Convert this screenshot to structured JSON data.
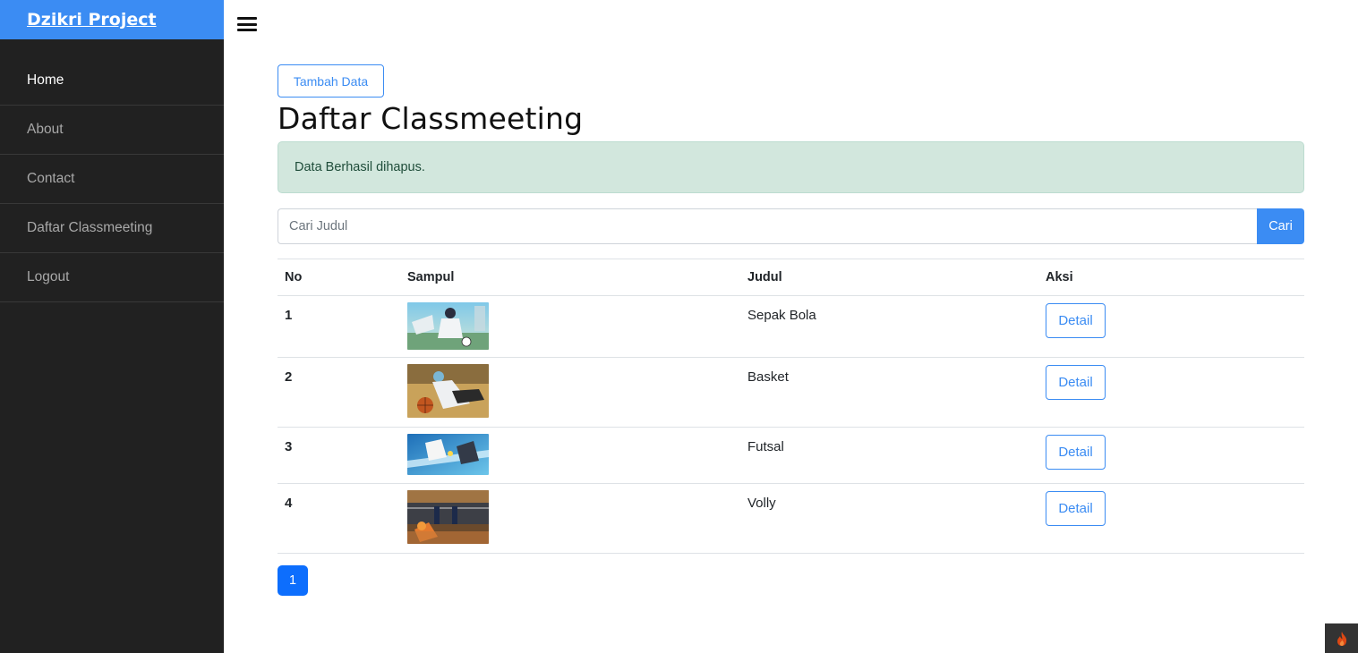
{
  "brand": {
    "name": "Dzikri Project"
  },
  "sidebar": {
    "items": [
      {
        "label": "Home",
        "active": true
      },
      {
        "label": "About",
        "active": false
      },
      {
        "label": "Contact",
        "active": false
      },
      {
        "label": "Daftar Classmeeting",
        "active": false
      },
      {
        "label": "Logout",
        "active": false
      }
    ]
  },
  "main": {
    "add_button": "Tambah Data",
    "title": "Daftar Classmeeting",
    "alert": "Data Berhasil dihapus.",
    "search": {
      "placeholder": "Cari Judul",
      "value": "",
      "button": "Cari"
    },
    "table": {
      "headers": [
        "No",
        "Sampul",
        "Judul",
        "Aksi"
      ],
      "rows": [
        {
          "no": "1",
          "judul": "Sepak Bola",
          "aksi": "Detail"
        },
        {
          "no": "2",
          "judul": "Basket",
          "aksi": "Detail"
        },
        {
          "no": "3",
          "judul": "Futsal",
          "aksi": "Detail"
        },
        {
          "no": "4",
          "judul": "Volly",
          "aksi": "Detail"
        }
      ]
    },
    "pagination": {
      "current": "1"
    }
  },
  "colors": {
    "primary": "#3b8cf3",
    "sidebar_bg": "#212121",
    "alert_bg": "#d2e7dd",
    "pager": "#0d6efd"
  },
  "icons": {
    "menu": "hamburger-icon",
    "debug": "codeigniter-flame-icon"
  }
}
